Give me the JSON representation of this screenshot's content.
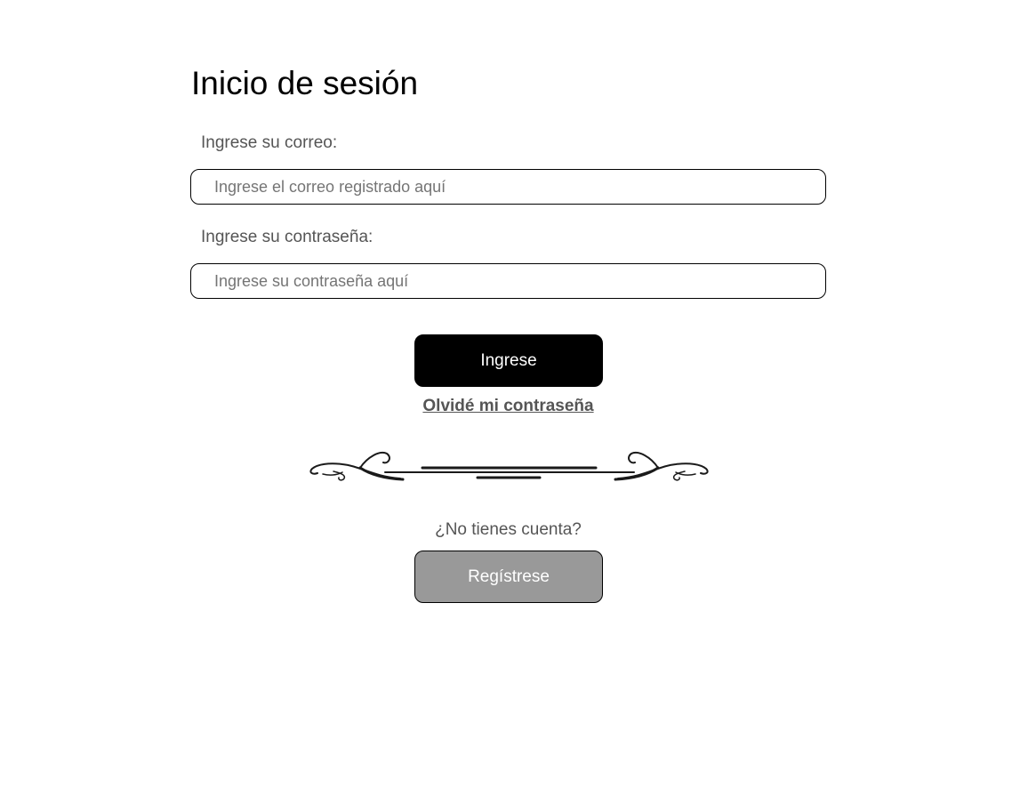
{
  "page": {
    "title": "Inicio de sesión"
  },
  "form": {
    "email_label": "Ingrese su correo:",
    "email_placeholder": "Ingrese el correo registrado aquí",
    "email_value": "",
    "password_label": "Ingrese su contraseña:",
    "password_placeholder": "Ingrese su contraseña aquí",
    "password_value": "",
    "submit_label": "Ingrese",
    "forgot_label": "Olvidé mi contraseña"
  },
  "divider": {
    "icon": "ornamental-divider-icon"
  },
  "register": {
    "prompt": "¿No tienes cuenta?",
    "button_label": "Regístrese"
  },
  "colors": {
    "primary_button": "#000000",
    "secondary_button": "#999999",
    "label_text": "#555555"
  }
}
